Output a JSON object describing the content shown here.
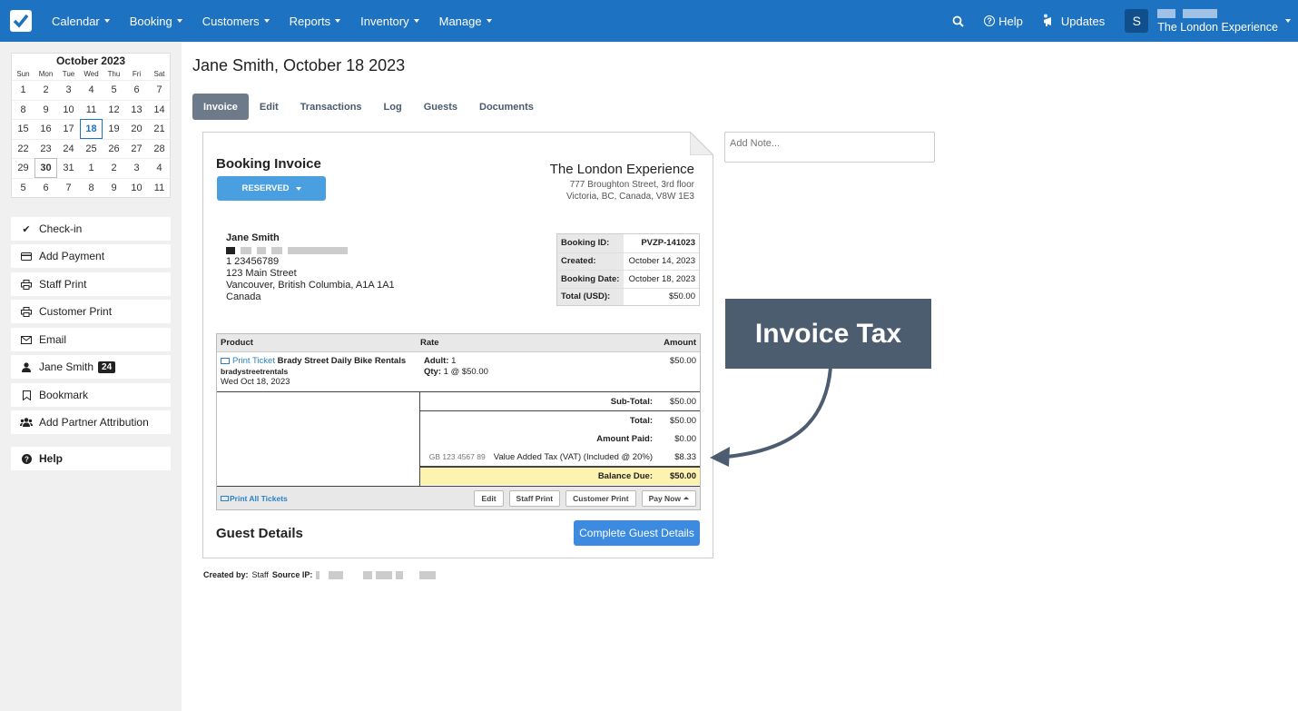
{
  "nav": {
    "items": [
      "Calendar",
      "Booking",
      "Customers",
      "Reports",
      "Inventory",
      "Manage"
    ],
    "help": "Help",
    "updates": "Updates",
    "avatar_letter": "S",
    "account_name": "The London Experience"
  },
  "calendar": {
    "title": "October 2023",
    "dow": [
      "Sun",
      "Mon",
      "Tue",
      "Wed",
      "Thu",
      "Fri",
      "Sat"
    ],
    "days": [
      1,
      2,
      3,
      4,
      5,
      6,
      7,
      8,
      9,
      10,
      11,
      12,
      13,
      14,
      15,
      16,
      17,
      18,
      19,
      20,
      21,
      22,
      23,
      24,
      25,
      26,
      27,
      28,
      29,
      30,
      31,
      1,
      2,
      3,
      4,
      5,
      6,
      7,
      8,
      9,
      10,
      11
    ],
    "today": 18,
    "selected": 30
  },
  "sidebar": {
    "buttons": [
      "Check-in",
      "Add Payment",
      "Staff Print",
      "Customer Print",
      "Email",
      "Jane Smith",
      "Bookmark",
      "Add Partner Attribution"
    ],
    "badge": "24",
    "help": "Help"
  },
  "page": {
    "title": "Jane Smith, October 18 2023",
    "tabs": [
      "Invoice",
      "Edit",
      "Transactions",
      "Log",
      "Guests",
      "Documents"
    ]
  },
  "invoice": {
    "title": "Booking Invoice",
    "status": "RESERVED",
    "company": {
      "name": "The London Experience",
      "addr1": "777 Broughton Street, 3rd floor",
      "addr2": "Victoria, BC, Canada, V8W 1E3"
    },
    "customer": {
      "name": "Jane Smith",
      "phone": "1 23456789",
      "street": "123 Main Street",
      "city": "Vancouver, British Columbia, A1A 1A1",
      "country": "Canada"
    },
    "meta": [
      {
        "k": "Booking ID:",
        "v": "PVZP-141023"
      },
      {
        "k": "Created:",
        "v": "October 14, 2023"
      },
      {
        "k": "Booking Date:",
        "v": "October 18, 2023"
      },
      {
        "k": "Total (USD):",
        "v": "$50.00"
      }
    ],
    "headers": {
      "product": "Product",
      "rate": "Rate",
      "amount": "Amount"
    },
    "item": {
      "print_ticket": "Print Ticket",
      "product": "Brady Street Daily Bike Rentals",
      "vendor": "bradystreetrentals",
      "date": "Wed Oct 18, 2023",
      "adult_label": "Adult:",
      "adult_val": "1",
      "qty_label": "Qty:",
      "qty_val": "1 @ $50.00",
      "amount": "$50.00"
    },
    "totals": {
      "subtotal_label": "Sub-Total:",
      "subtotal": "$50.00",
      "total_label": "Total:",
      "total": "$50.00",
      "paid_label": "Amount Paid:",
      "paid": "$0.00",
      "vat_code": "GB 123 4567 89",
      "vat_label": "Value Added Tax (VAT) (Included @ 20%)",
      "vat": "$8.33",
      "balance_label": "Balance Due:",
      "balance": "$50.00"
    },
    "footer": {
      "print_all": "Print All Tickets",
      "edit": "Edit",
      "staff_print": "Staff Print",
      "customer_print": "Customer Print",
      "pay_now": "Pay Now"
    },
    "guest_title": "Guest Details",
    "guest_button": "Complete Guest Details"
  },
  "created": {
    "label": "Created by:",
    "value": "Staff",
    "ip_label": "Source IP:"
  },
  "note_placeholder": "Add Note...",
  "callout": "Invoice Tax",
  "colors": {
    "nav": "#1d72c2",
    "callout": "#4d5d70",
    "balance_bg": "#fdf2b0",
    "reserved": "#4a9fe0"
  }
}
